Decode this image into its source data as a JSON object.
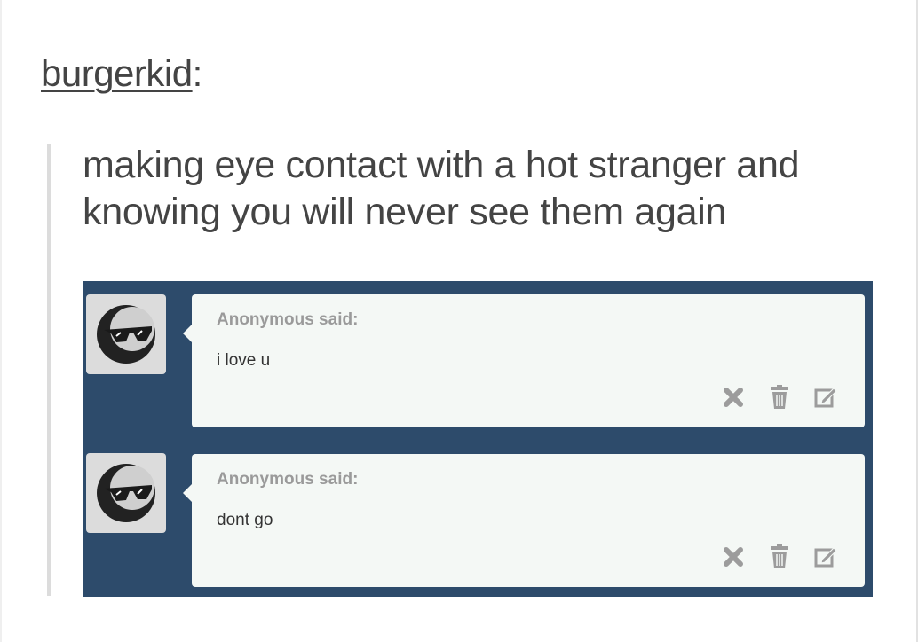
{
  "post": {
    "author": "burgerkid",
    "author_suffix": ":",
    "text_line1": "making eye contact with a hot stranger and",
    "text_line2": "knowing you will never see them again"
  },
  "asks": [
    {
      "asker": "Anonymous said:",
      "question": "i love u",
      "avatar_icon": "sunglasses-moon-avatar-icon"
    },
    {
      "asker": "Anonymous said:",
      "question": "dont go",
      "avatar_icon": "sunglasses-moon-avatar-icon"
    }
  ],
  "colors": {
    "panel": "#2d4b6b",
    "bubble": "#f4f8f5",
    "icon": "#9c9c9c"
  }
}
